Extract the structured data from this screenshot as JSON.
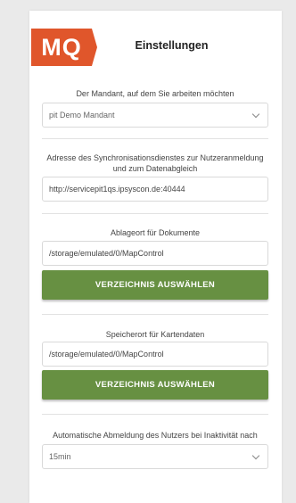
{
  "app": {
    "logo_text": "MQ",
    "title": "Einstellungen"
  },
  "mandant": {
    "label": "Der Mandant, auf dem Sie arbeiten möchten",
    "selected": "pit Demo Mandant"
  },
  "sync": {
    "label": "Adresse des Synchronisationsdienstes zur Nutzeranmeldung und zum Datenabgleich",
    "value": "http://servicepit1qs.ipsyscon.de:40444"
  },
  "documents": {
    "label": "Ablageort für Dokumente",
    "value": "/storage/emulated/0/MapControl",
    "button_label": "VERZEICHNIS AUSWÄHLEN"
  },
  "mapdata": {
    "label": "Speicherort für Kartendaten",
    "value": "/storage/emulated/0/MapControl",
    "button_label": "VERZEICHNIS AUSWÄHLEN"
  },
  "autologout": {
    "label": "Automatische Abmeldung des Nutzers bei Inaktivität nach",
    "selected": "15min"
  },
  "colors": {
    "brand": "#e0562b",
    "button": "#679042"
  }
}
